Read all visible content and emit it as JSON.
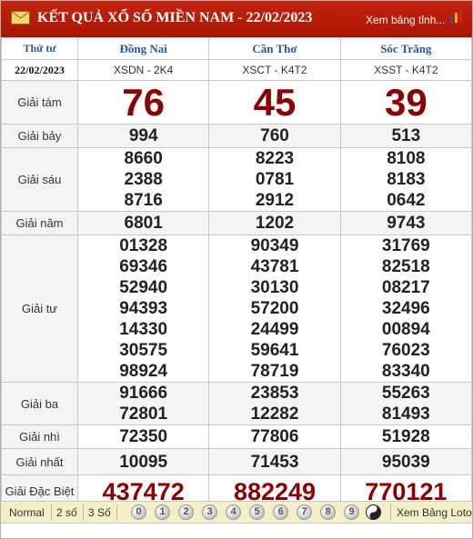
{
  "header": {
    "title": "KẾT QUẢ XỔ SỐ MIỀN NAM - 22/02/2023",
    "view_link": "Xem bảng tỉnh..."
  },
  "table": {
    "weekday": "Thứ tư",
    "date": "22/02/2023",
    "provinces": [
      {
        "name": "Đồng Nai",
        "code": "XSDN - 2K4"
      },
      {
        "name": "Cần Thơ",
        "code": "XSCT - K4T2"
      },
      {
        "name": "Sóc Trăng",
        "code": "XSST - K4T2"
      }
    ],
    "prizes": [
      {
        "label": "Giải tám",
        "values": [
          [
            "76"
          ],
          [
            "45"
          ],
          [
            "39"
          ]
        ]
      },
      {
        "label": "Giải bảy",
        "values": [
          [
            "994"
          ],
          [
            "760"
          ],
          [
            "513"
          ]
        ]
      },
      {
        "label": "Giải sáu",
        "values": [
          [
            "8660",
            "2388",
            "8716"
          ],
          [
            "8223",
            "0781",
            "2912"
          ],
          [
            "8108",
            "8183",
            "0642"
          ]
        ]
      },
      {
        "label": "Giải năm",
        "values": [
          [
            "6801"
          ],
          [
            "1202"
          ],
          [
            "9743"
          ]
        ]
      },
      {
        "label": "Giải tư",
        "values": [
          [
            "01328",
            "69346",
            "52940",
            "94393",
            "14330",
            "30575",
            "98924"
          ],
          [
            "90349",
            "43781",
            "30130",
            "57200",
            "24499",
            "59641",
            "78719"
          ],
          [
            "31769",
            "82518",
            "08217",
            "32496",
            "00894",
            "76023",
            "83340"
          ]
        ]
      },
      {
        "label": "Giải ba",
        "values": [
          [
            "91666",
            "72801"
          ],
          [
            "23853",
            "12282"
          ],
          [
            "55263",
            "81493"
          ]
        ]
      },
      {
        "label": "Giải nhì",
        "values": [
          [
            "72350"
          ],
          [
            "77806"
          ],
          [
            "51928"
          ]
        ]
      },
      {
        "label": "Giải nhất",
        "values": [
          [
            "10095"
          ],
          [
            "71453"
          ],
          [
            "95039"
          ]
        ]
      },
      {
        "label": "Giải Đặc Biệt",
        "values": [
          [
            "437472"
          ],
          [
            "882249"
          ],
          [
            "770121"
          ]
        ]
      }
    ]
  },
  "footer": {
    "mode_normal": "Normal",
    "mode_2": "2 số",
    "mode_3": "3 Số",
    "digits": [
      "0",
      "1",
      "2",
      "3",
      "4",
      "5",
      "6",
      "7",
      "8",
      "9"
    ],
    "loto_link": "Xem Bảng Loto"
  },
  "colors": {
    "header_red": "#b81c06",
    "prize_red": "#8b0000",
    "province_blue": "#2b55a8",
    "footer_bg": "#f5efc8"
  }
}
